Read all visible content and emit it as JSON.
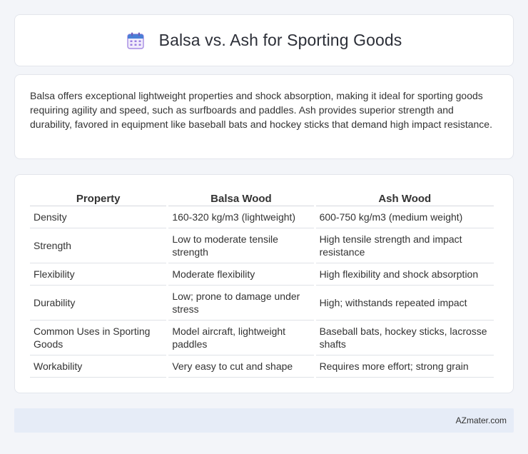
{
  "header": {
    "title": "Balsa vs. Ash for Sporting Goods",
    "icon": "calendar-icon"
  },
  "summary": {
    "text": "Balsa offers exceptional lightweight properties and shock absorption, making it ideal for sporting goods requiring agility and speed, such as surfboards and paddles. Ash provides superior strength and durability, favored in equipment like baseball bats and hockey sticks that demand high impact resistance."
  },
  "table": {
    "headers": [
      "Property",
      "Balsa Wood",
      "Ash Wood"
    ],
    "rows": [
      [
        "Density",
        "160-320 kg/m3 (lightweight)",
        "600-750 kg/m3 (medium weight)"
      ],
      [
        "Strength",
        "Low to moderate tensile strength",
        "High tensile strength and impact resistance"
      ],
      [
        "Flexibility",
        "Moderate flexibility",
        "High flexibility and shock absorption"
      ],
      [
        "Durability",
        "Low; prone to damage under stress",
        "High; withstands repeated impact"
      ],
      [
        "Common Uses in Sporting Goods",
        "Model aircraft, lightweight paddles",
        "Baseball bats, hockey sticks, lacrosse shafts"
      ],
      [
        "Workability",
        "Very easy to cut and shape",
        "Requires more effort; strong grain"
      ]
    ]
  },
  "footer": {
    "text": "AZmater.com"
  },
  "colors": {
    "background": "#f3f5f9",
    "card": "#ffffff",
    "footer_bar": "#e6ecf7",
    "icon_blue": "#4a7fd6",
    "icon_purple": "#9b7fe0"
  }
}
